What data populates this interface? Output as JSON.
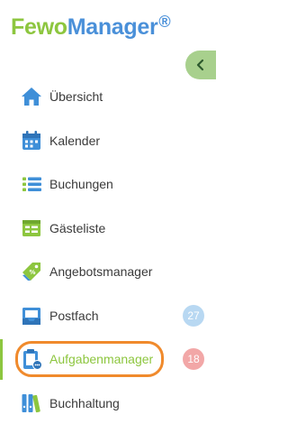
{
  "logo": {
    "part1": "Fewo",
    "part2": "Manager",
    "reg": "®"
  },
  "collapse_button": {
    "icon": "chevron-left-icon"
  },
  "colors": {
    "brand_green": "#8dc63f",
    "brand_blue": "#4a90d9",
    "highlight_orange": "#f08a2c",
    "badge_blue": "#b8d8f2",
    "badge_red": "#f2a7a7"
  },
  "menu": {
    "items": [
      {
        "id": "uebersicht",
        "label": "Übersicht",
        "icon": "home-icon"
      },
      {
        "id": "kalender",
        "label": "Kalender",
        "icon": "calendar-icon"
      },
      {
        "id": "buchungen",
        "label": "Buchungen",
        "icon": "list-icon"
      },
      {
        "id": "gaesteliste",
        "label": "Gästeliste",
        "icon": "guest-list-icon"
      },
      {
        "id": "angebotsmanager",
        "label": "Angebotsmanager",
        "icon": "tag-icon"
      },
      {
        "id": "postfach",
        "label": "Postfach",
        "icon": "inbox-icon",
        "badge": "27"
      },
      {
        "id": "aufgabenmanager",
        "label": "Aufgabenmanager",
        "icon": "clipboard-icon",
        "badge": "18",
        "active": true
      },
      {
        "id": "buchhaltung",
        "label": "Buchhaltung",
        "icon": "binders-icon"
      }
    ]
  }
}
